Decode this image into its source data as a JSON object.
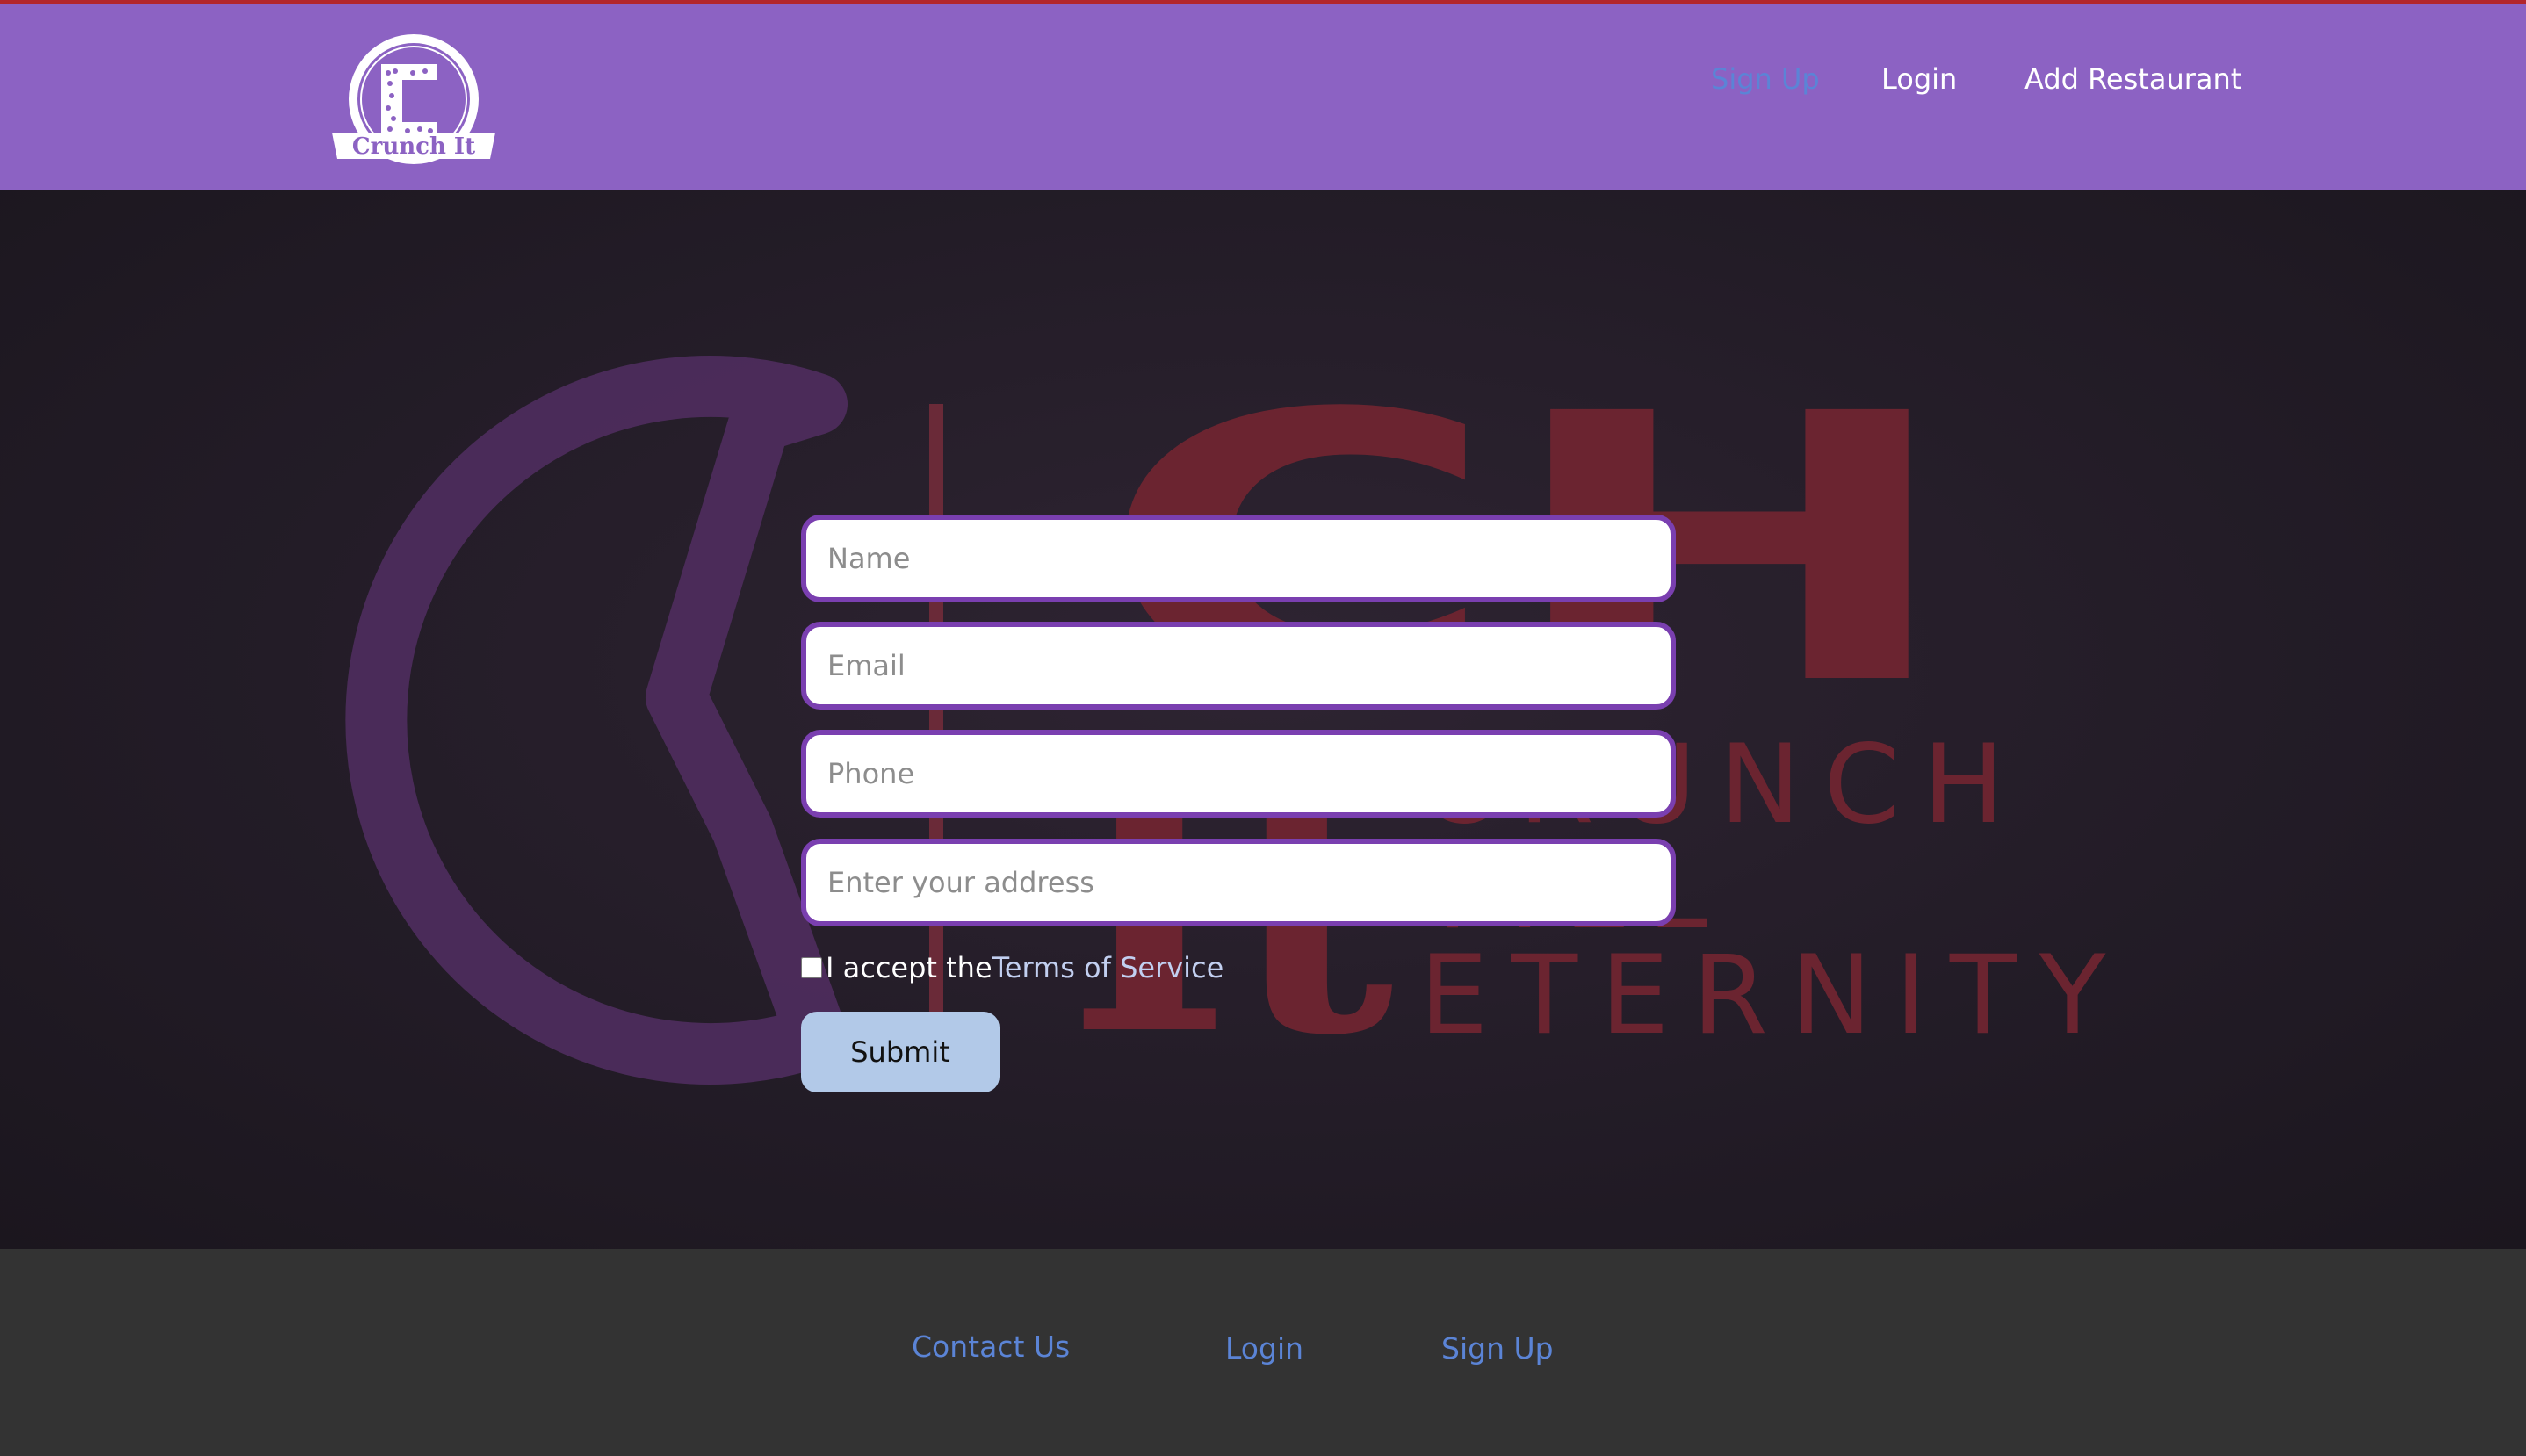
{
  "header": {
    "logo": {
      "brand": "Crunch It",
      "tagline": "CRUNCH TILL ETERNITY"
    },
    "nav": {
      "signup": "Sign Up",
      "login": "Login",
      "add_restaurant": "Add Restaurant"
    },
    "active_nav": "Sign Up"
  },
  "hero": {
    "background_logo": {
      "word": "CH",
      "it": "It",
      "tagline_lines": [
        "CRUNCH",
        "TILL",
        "ETERNITY"
      ]
    }
  },
  "form": {
    "name": {
      "value": "",
      "placeholder": "Name"
    },
    "email": {
      "value": "",
      "placeholder": "Email"
    },
    "phone": {
      "value": "",
      "placeholder": "Phone"
    },
    "address": {
      "value": "",
      "placeholder": "Enter your address"
    },
    "terms_checked": false,
    "terms_prefix": "I accept the",
    "terms_link": "Terms of Service",
    "submit_label": "Submit"
  },
  "footer": {
    "contact": "Contact Us",
    "login": "Login",
    "signup": "Sign Up"
  },
  "colors": {
    "header_bg": "#8c62c3",
    "top_accent": "#b3262b",
    "input_border": "#7a3fb0",
    "link_blue": "#5b84d6",
    "submit_bg": "#b2c9e8",
    "footer_bg": "#333333",
    "hero_bg": "#231c27"
  }
}
